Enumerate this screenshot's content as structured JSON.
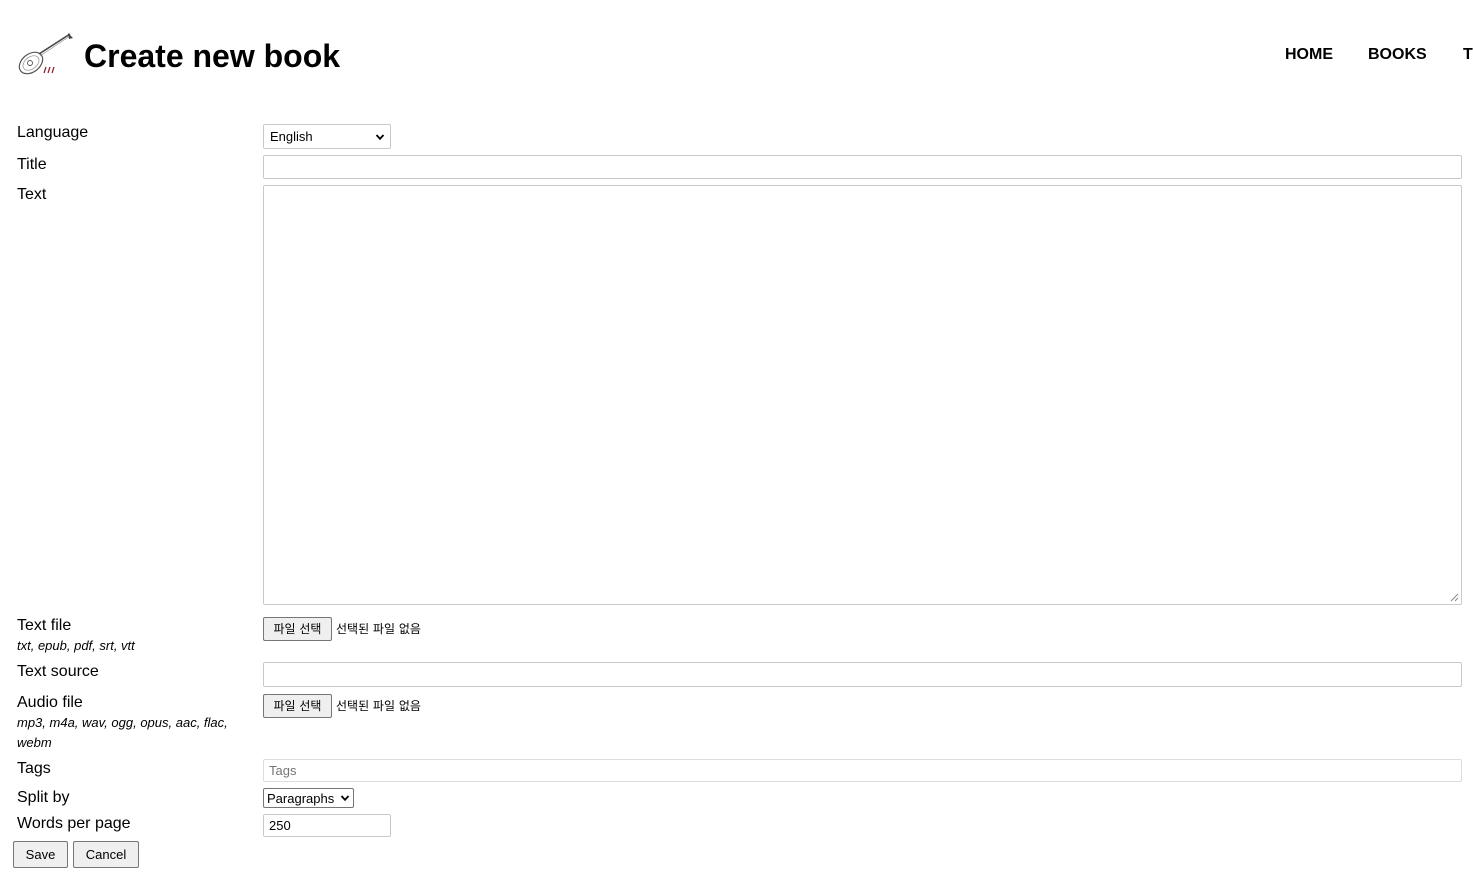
{
  "header": {
    "title": "Create new book",
    "logo_icon": "lute-logo-icon",
    "nav": [
      "HOME",
      "BOOKS",
      "T"
    ]
  },
  "form": {
    "language": {
      "label": "Language",
      "value": "English"
    },
    "title": {
      "label": "Title",
      "value": ""
    },
    "text": {
      "label": "Text",
      "value": ""
    },
    "text_file": {
      "label": "Text file",
      "hint": "txt, epub, pdf, srt, vtt",
      "button": "파일 선택",
      "status": "선택된 파일 없음"
    },
    "text_source": {
      "label": "Text source",
      "value": ""
    },
    "audio_file": {
      "label": "Audio file",
      "hint": "mp3, m4a, wav, ogg, opus, aac, flac, webm",
      "button": "파일 선택",
      "status": "선택된 파일 없음"
    },
    "tags": {
      "label": "Tags",
      "placeholder": "Tags"
    },
    "split_by": {
      "label": "Split by",
      "value": "Paragraphs"
    },
    "words_per_page": {
      "label": "Words per page",
      "value": "250"
    }
  },
  "actions": {
    "save": "Save",
    "cancel": "Cancel"
  },
  "colors": {
    "accent": "#8b1a2b",
    "border": "#c9c9c9",
    "button_bg": "#efefef"
  }
}
